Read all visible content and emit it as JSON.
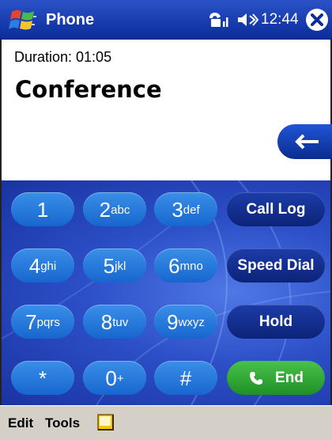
{
  "titlebar": {
    "title": "Phone",
    "time": "12:44",
    "icons": [
      "start-flag-icon",
      "signal-icon",
      "speaker-icon",
      "close-icon"
    ]
  },
  "call": {
    "duration": "Duration: 01:05",
    "name": "Conference"
  },
  "keypad": {
    "keys": [
      {
        "digit": "1",
        "letters": ""
      },
      {
        "digit": "2",
        "letters": "abc"
      },
      {
        "digit": "3",
        "letters": "def"
      },
      {
        "digit": "4",
        "letters": "ghi"
      },
      {
        "digit": "5",
        "letters": "jkl"
      },
      {
        "digit": "6",
        "letters": "mno"
      },
      {
        "digit": "7",
        "letters": "pqrs"
      },
      {
        "digit": "8",
        "letters": "tuv"
      },
      {
        "digit": "9",
        "letters": "wxyz"
      },
      {
        "digit": "*",
        "letters": ""
      },
      {
        "digit": "0",
        "letters": "+"
      },
      {
        "digit": "#",
        "letters": ""
      }
    ],
    "commands": {
      "call_log": "Call Log",
      "speed_dial": "Speed Dial",
      "hold": "Hold",
      "end": "End"
    }
  },
  "menubar": {
    "edit": "Edit",
    "tools": "Tools"
  },
  "colors": {
    "titlebar": "#0b2c9a",
    "digit_key": "#1f75dc",
    "command_key": "#132f8e",
    "end_key": "#2ea533",
    "menubar": "#d4d0c8"
  }
}
